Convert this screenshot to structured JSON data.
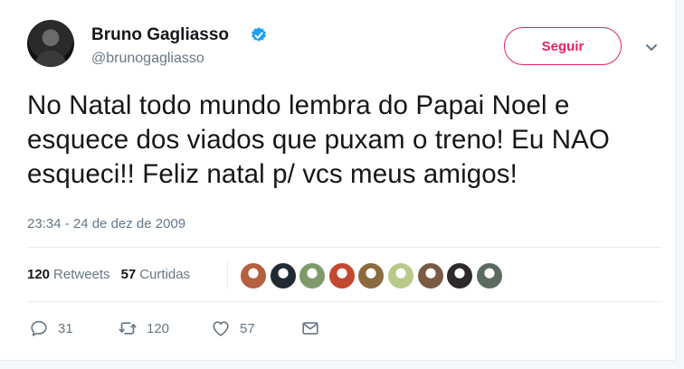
{
  "tweet": {
    "author_name": "Bruno Gagliasso",
    "author_handle": "@brunogagliasso",
    "follow_label": "Seguir",
    "text": "No Natal todo mundo lembra do Papai Noel e esquece dos viados que puxam o treno! Eu NAO esqueci!! Feliz natal p/ vcs meus amigos!",
    "timestamp": "23:34 - 24 de dez de 2009"
  },
  "stats": {
    "retweets_count": "120",
    "retweets_label": "Retweets",
    "likes_count": "57",
    "likes_label": "Curtidas"
  },
  "likers": [
    {
      "color": "#b5603f"
    },
    {
      "color": "#1f2a33"
    },
    {
      "color": "#7e9a6a"
    },
    {
      "color": "#c2482f"
    },
    {
      "color": "#8b6a3d"
    },
    {
      "color": "#b9c98a"
    },
    {
      "color": "#7a5a44"
    },
    {
      "color": "#2f2a2a"
    },
    {
      "color": "#5b6b5e"
    }
  ],
  "actions": {
    "reply_count": "31",
    "retweet_count": "120",
    "like_count": "57"
  },
  "colors": {
    "accent": "#e0245e",
    "verified": "#1da1f2",
    "muted": "#657786"
  }
}
